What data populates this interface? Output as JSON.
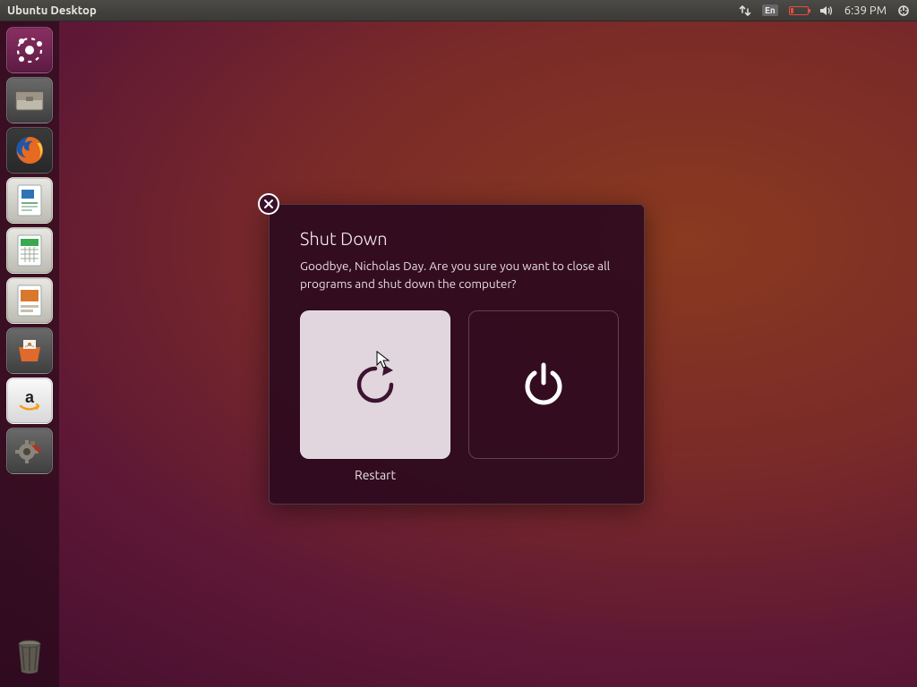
{
  "menubar": {
    "title": "Ubuntu Desktop"
  },
  "tray": {
    "language": "En",
    "time": "6:39 PM"
  },
  "launcher": {
    "items": [
      {
        "name": "dash-icon"
      },
      {
        "name": "files-icon"
      },
      {
        "name": "firefox-icon"
      },
      {
        "name": "writer-icon"
      },
      {
        "name": "calc-icon"
      },
      {
        "name": "impress-icon"
      },
      {
        "name": "software-center-icon"
      },
      {
        "name": "amazon-icon"
      },
      {
        "name": "settings-icon"
      }
    ],
    "trash": "trash-icon"
  },
  "dialog": {
    "title": "Shut Down",
    "message": "Goodbye, Nicholas Day. Are you sure you want to close all programs and shut down the computer?",
    "restart_label": "Restart",
    "shutdown_label": ""
  }
}
